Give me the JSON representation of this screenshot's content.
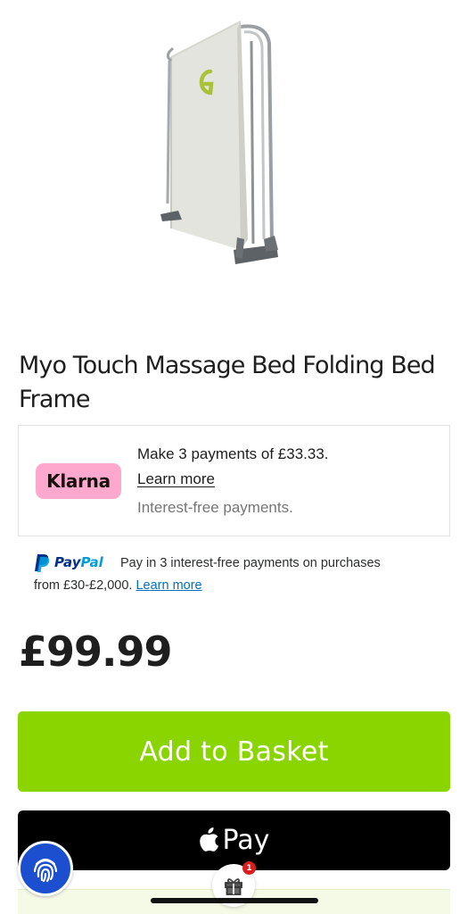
{
  "product": {
    "title": "Myo Touch Massage Bed Folding Bed Frame",
    "price": "£99.99",
    "image_icon": "folding-bed-image"
  },
  "klarna": {
    "logo": "Klarna",
    "line1": "Make 3 payments of £33.33.",
    "link": "Learn more",
    "line3": "Interest-free payments.",
    "badge_color": "#ffa8cd"
  },
  "paypal": {
    "logo_pay": "Pay",
    "logo_pal": "Pal",
    "text1": "Pay in 3 interest-free payments on purchases",
    "text2": "from £30-£2,000.",
    "link": "Learn more"
  },
  "actions": {
    "add_to_basket": "Add to Basket",
    "apple_pay": "Pay",
    "add_color": "#8ad400"
  },
  "floating": {
    "gift_badge_count": "1"
  }
}
